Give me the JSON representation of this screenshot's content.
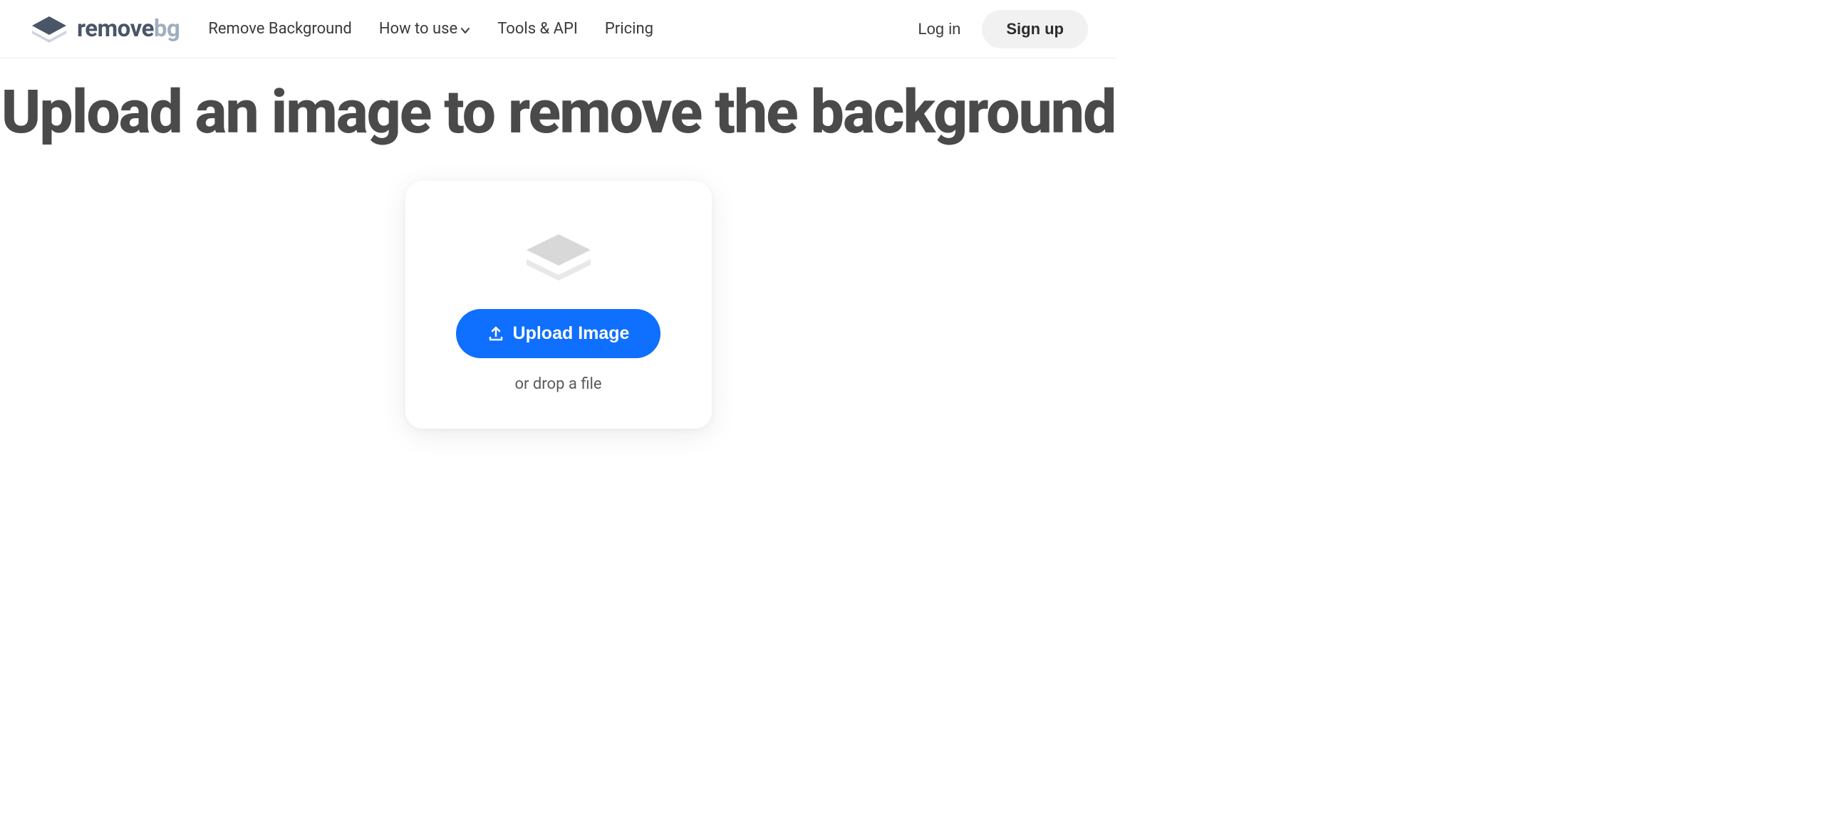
{
  "logo": {
    "text_main": "remove",
    "text_suffix": "bg"
  },
  "nav": {
    "items": [
      {
        "label": "Remove Background"
      },
      {
        "label": "How to use",
        "hasDropdown": true
      },
      {
        "label": "Tools & API"
      },
      {
        "label": "Pricing"
      }
    ]
  },
  "auth": {
    "login": "Log in",
    "signup": "Sign up"
  },
  "main": {
    "title": "Upload an image to remove the background",
    "upload_button": "Upload Image",
    "drop_text": "or drop a file"
  }
}
